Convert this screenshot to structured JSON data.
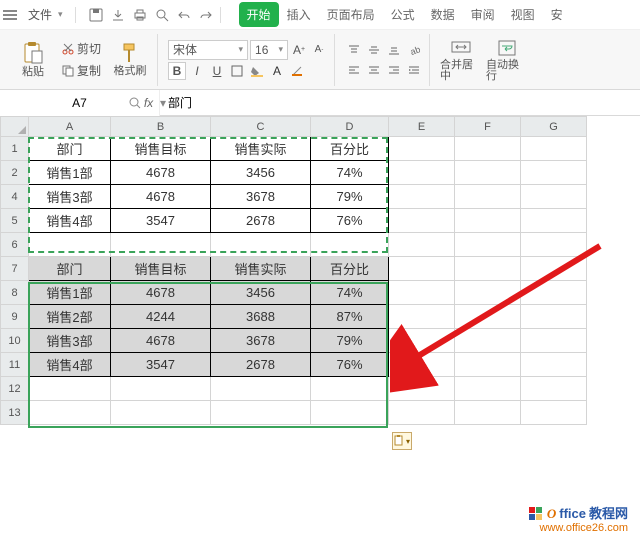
{
  "menubar": {
    "file": "文件",
    "qat": {
      "save": "保存",
      "export": "导出",
      "print": "打印",
      "preview": "预览",
      "undo": "撤销",
      "redo": "重做"
    }
  },
  "tabs": {
    "start": "开始",
    "insert": "插入",
    "layout": "页面布局",
    "formula": "公式",
    "data": "数据",
    "review": "审阅",
    "view": "视图",
    "security": "安"
  },
  "ribbon": {
    "paste": "粘贴",
    "cut": "剪切",
    "copy": "复制",
    "fmtpaint": "格式刷",
    "font_name": "宋体",
    "font_size": "16",
    "merge": "合并居中",
    "wrap": "自动换行"
  },
  "fx": {
    "namebox": "A7",
    "formula": "部门"
  },
  "columns": [
    "A",
    "B",
    "C",
    "D",
    "E",
    "F",
    "G"
  ],
  "rows": [
    "1",
    "2",
    "4",
    "5",
    "6",
    "7",
    "8",
    "9",
    "10",
    "11",
    "12",
    "13"
  ],
  "chart_data": {
    "type": "table",
    "table1": {
      "headers": [
        "部门",
        "销售目标",
        "销售实际",
        "百分比"
      ],
      "rows": [
        [
          "销售1部",
          "4678",
          "3456",
          "74%"
        ],
        [
          "销售3部",
          "4678",
          "3678",
          "79%"
        ],
        [
          "销售4部",
          "3547",
          "2678",
          "76%"
        ]
      ]
    },
    "table2": {
      "headers": [
        "部门",
        "销售目标",
        "销售实际",
        "百分比"
      ],
      "rows": [
        [
          "销售1部",
          "4678",
          "3456",
          "74%"
        ],
        [
          "销售2部",
          "4244",
          "3688",
          "87%"
        ],
        [
          "销售3部",
          "4678",
          "3678",
          "79%"
        ],
        [
          "销售4部",
          "3547",
          "2678",
          "76%"
        ]
      ]
    }
  },
  "watermark": {
    "brand1": "O",
    "brand2": "ffice",
    "brand3": "教程网",
    "url": "www.office26.com"
  }
}
